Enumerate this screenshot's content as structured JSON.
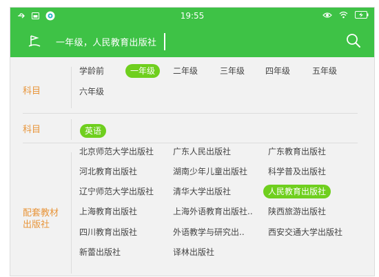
{
  "statusbar": {
    "time": "19:55",
    "left_icons": [
      "usb-icon",
      "image-icon",
      "eye-app-icon"
    ],
    "right_icons": [
      "eye-icon",
      "wifi-icon",
      "battery-charging-icon"
    ]
  },
  "header": {
    "title": "一年级，人民教育出版社",
    "icon": "flag-icon",
    "search_icon": "search-icon"
  },
  "subject_row": {
    "label": "科目",
    "options": [
      "学龄前",
      "一年级",
      "二年级",
      "三年级",
      "四年级",
      "五年级",
      "六年级"
    ],
    "selected": "一年级"
  },
  "course_row": {
    "label": "科目",
    "options": [
      "英语"
    ],
    "selected": "英语"
  },
  "publisher_row": {
    "label_line1": "配套教材",
    "label_line2": "出版社",
    "options": [
      "北京师范大学出版社",
      "广东人民出版社",
      "广东教育出版社",
      "河北教育出版社",
      "湖南少年儿童出版社",
      "科学普及出版社",
      "辽宁师范大学出版社",
      "清华大学出版社",
      "人民教育出版社",
      "上海教育出版社",
      "上海外语教育出版社..",
      "陕西旅游出版社",
      "四川教育出版社",
      "外语教学与研究出..",
      "西安交通大学出版社",
      "新蕾出版社",
      "译林出版社"
    ],
    "selected": "人民教育出版社"
  },
  "colors": {
    "accent_green": "#3ec246",
    "selected_chip": "#6fcf1e",
    "label_orange": "#e8953a",
    "background": "#f2f2f2"
  }
}
